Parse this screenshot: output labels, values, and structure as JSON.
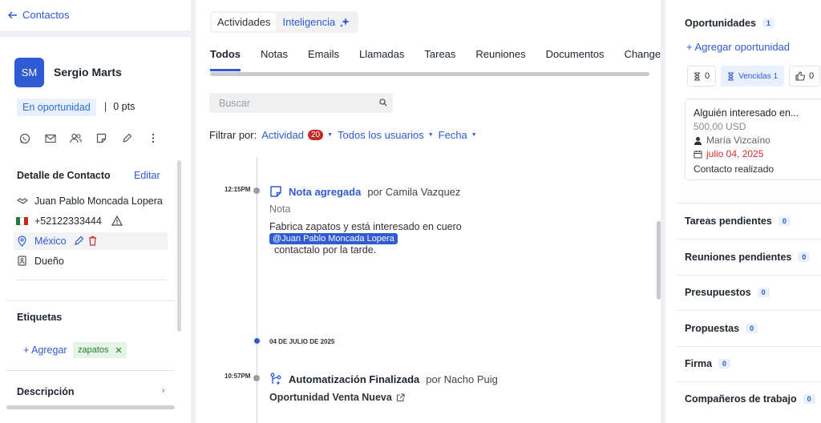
{
  "back": {
    "label": "Contactos"
  },
  "contact": {
    "initials": "SM",
    "name": "Sergio Marts",
    "stage": "En oportunidad",
    "points": "0 pts"
  },
  "action_icons": [
    "whatsapp-icon",
    "email-icon",
    "users-icon",
    "note-icon",
    "edit-icon",
    "more-icon"
  ],
  "details": {
    "title": "Detalle de Contacto",
    "edit_label": "Editar",
    "owner_name": "Juan Pablo Moncada Lopera",
    "phone": "+52122333444",
    "country": "México",
    "owner_label": "Dueño"
  },
  "tags": {
    "title": "Etiquetas",
    "add_label": "+ Agregar",
    "items": [
      "zapatos"
    ]
  },
  "description": {
    "title": "Descripción"
  },
  "mode": {
    "activities": "Actividades",
    "intelligence": "Inteligencia"
  },
  "tabs": [
    "Todos",
    "Notas",
    "Emails",
    "Llamadas",
    "Tareas",
    "Reuniones",
    "Documentos",
    "Changelog"
  ],
  "search": {
    "placeholder": "Buscar"
  },
  "filters": {
    "label": "Filtrar por:",
    "activity": "Actividad",
    "activity_count": "20",
    "users": "Todos los usuarios",
    "date": "Fecha"
  },
  "timeline": {
    "entry1": {
      "time": "12:15PM",
      "title": "Nota agregada",
      "by": "por Camila Vazquez",
      "label": "Nota",
      "body": "Fabrica zapatos y está interesado en cuero",
      "mention": "@Juan Pablo Moncada Lopera",
      "body2": "contactalo por la tarde."
    },
    "date_sep": "04 DE JULIO DE 2025",
    "entry2": {
      "time": "10:57PM",
      "title": "Automatización Finalizada",
      "by": "por Nacho Puig",
      "link": "Oportunidad Venta Nueva"
    }
  },
  "right": {
    "opps_title": "Oportunidades",
    "opps_count": "1",
    "add_opp": "+ Agregar oportunidad",
    "stats": {
      "pending": "0",
      "overdue": "Vencidas 1",
      "won": "0"
    },
    "card": {
      "title": "Alguién interesado en...",
      "amount": "500,00 USD",
      "person": "María Vizcaíno",
      "date": "julio 04, 2025",
      "status": "Contacto realizado"
    },
    "sections": [
      {
        "label": "Tareas pendientes",
        "count": "0"
      },
      {
        "label": "Reuniones pendientes",
        "count": "0"
      },
      {
        "label": "Presupuestos",
        "count": "0"
      },
      {
        "label": "Propuestas",
        "count": "0"
      },
      {
        "label": "Firma",
        "count": "0"
      },
      {
        "label": "Compañeros de trabajo",
        "count": "0"
      }
    ]
  },
  "colors": {
    "accent": "#2f5bd3",
    "danger": "#c62828",
    "tag_bg": "#e4f5e5"
  }
}
